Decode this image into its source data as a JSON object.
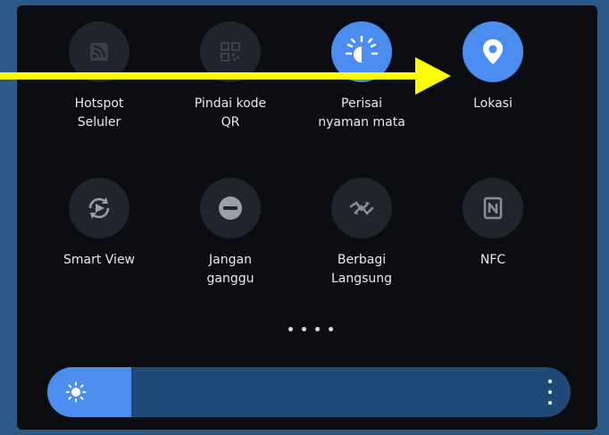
{
  "quick_panel": {
    "tiles": [
      {
        "label": "Hotspot\nSeluler",
        "icon": "hotspot-icon",
        "active": false
      },
      {
        "label": "Pindai kode\nQR",
        "icon": "qr-code-icon",
        "active": false
      },
      {
        "label": "Perisai\nnyaman mata",
        "icon": "eye-comfort-icon",
        "active": true
      },
      {
        "label": "Lokasi",
        "icon": "location-pin-icon",
        "active": true
      },
      {
        "label": "Smart View",
        "icon": "smart-view-icon",
        "active": false
      },
      {
        "label": "Jangan\nganggu",
        "icon": "do-not-disturb-icon",
        "active": false
      },
      {
        "label": "Berbagi\nLangsung",
        "icon": "quick-share-icon",
        "active": false
      },
      {
        "label": "NFC",
        "icon": "nfc-icon",
        "active": false
      }
    ],
    "page_indicator": {
      "pages": 4
    }
  },
  "brightness": {
    "level_percent": 16,
    "icon": "brightness-sun-icon",
    "more_icon": "more-options-icon"
  },
  "annotation": {
    "arrow_color": "#ffff00",
    "target": "Lokasi"
  },
  "colors": {
    "background": "#2c5a86",
    "panel": "#0b0d12",
    "tile_inactive": "#20242b",
    "tile_active": "#4b8cf0",
    "slider_track": "#1f4a78",
    "slider_fill": "#4d8df0"
  }
}
